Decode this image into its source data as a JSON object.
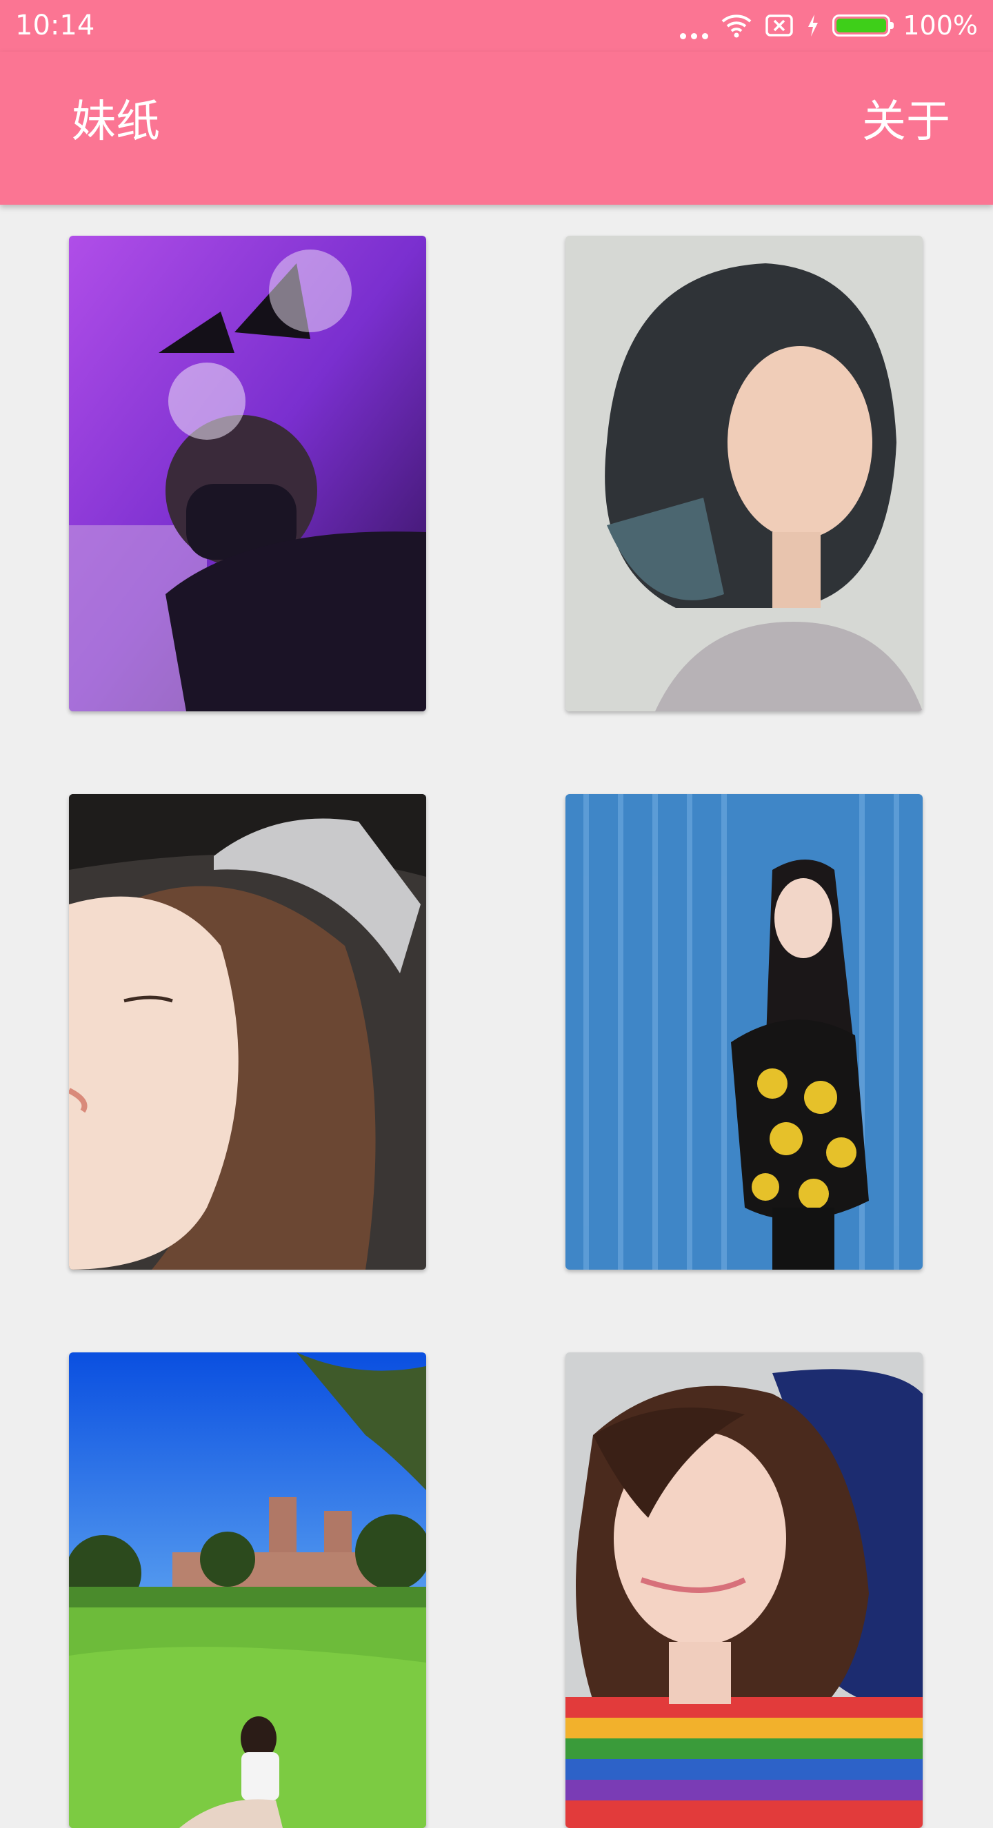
{
  "status_bar": {
    "time": "10:14",
    "battery_text": "100%",
    "icons": [
      "more-dots-icon",
      "wifi-icon",
      "no-sim-icon",
      "charging-icon",
      "battery-icon"
    ]
  },
  "app_bar": {
    "title": "妹纸",
    "action_label": "关于",
    "color": "#fb7593"
  },
  "photos": [
    {
      "subject": "girl with bow ears and mask, purple light"
    },
    {
      "subject": "girl with short bob hair"
    },
    {
      "subject": "girl with crown, eyes closed"
    },
    {
      "subject": "girl against blue wall, emoji sweater"
    },
    {
      "subject": "girl sitting on lawn, campus buildings, blue sky"
    },
    {
      "subject": "girl in rainbow striped shirt, car seat"
    }
  ]
}
